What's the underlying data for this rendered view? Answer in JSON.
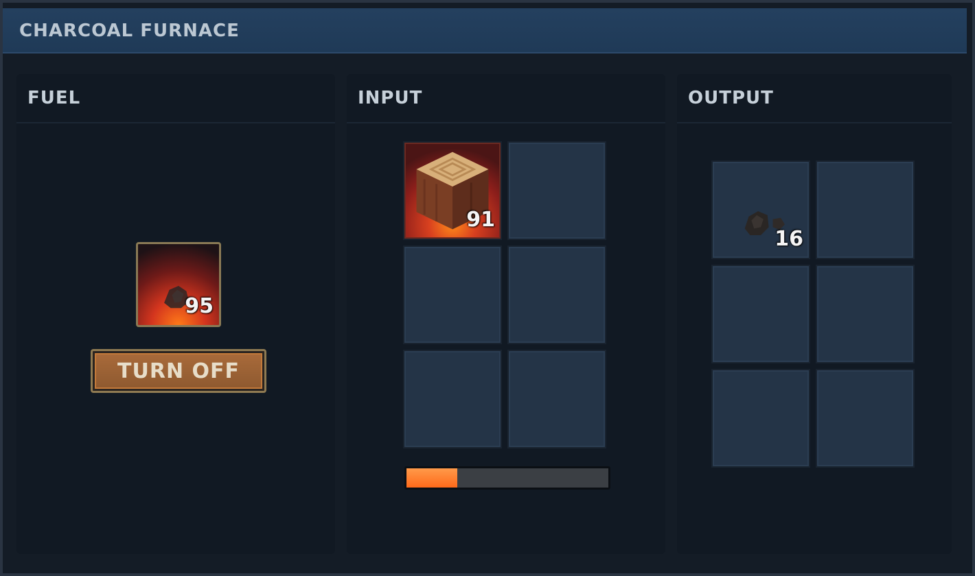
{
  "window": {
    "title": "CHARCOAL FURNACE"
  },
  "fuel": {
    "title": "FUEL",
    "slot": {
      "item_icon": "coal-lump-icon",
      "count": "95"
    },
    "toggle_label": "TURN OFF"
  },
  "input": {
    "title": "INPUT",
    "slots": [
      {
        "item_icon": "wood-log-icon",
        "count": "91"
      },
      {
        "item_icon": "",
        "count": ""
      },
      {
        "item_icon": "",
        "count": ""
      },
      {
        "item_icon": "",
        "count": ""
      },
      {
        "item_icon": "",
        "count": ""
      },
      {
        "item_icon": "",
        "count": ""
      }
    ],
    "progress_fraction": 0.25
  },
  "output": {
    "title": "OUTPUT",
    "slots": [
      {
        "item_icon": "charcoal-icon",
        "count": "16"
      },
      {
        "item_icon": "",
        "count": ""
      },
      {
        "item_icon": "",
        "count": ""
      },
      {
        "item_icon": "",
        "count": ""
      },
      {
        "item_icon": "",
        "count": ""
      },
      {
        "item_icon": "",
        "count": ""
      }
    ]
  },
  "colors": {
    "accent_orange": "#ff6a1a",
    "titlebar_blue": "#24405f",
    "button_brown": "#a86a3a"
  }
}
